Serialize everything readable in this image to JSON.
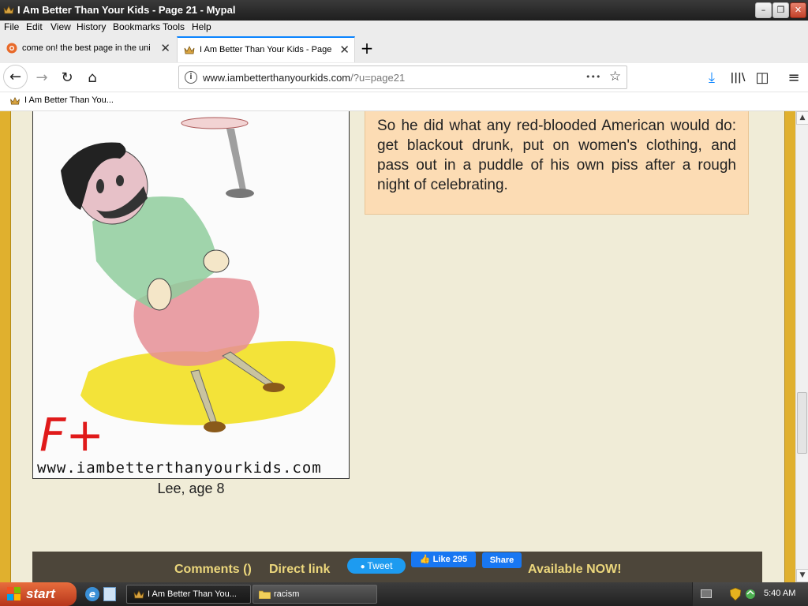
{
  "window": {
    "title": "I Am Better Than Your Kids - Page 21 - Mypal",
    "controls": {
      "minimize": "–",
      "maximize": "❐",
      "close": "✕"
    }
  },
  "menu": [
    "File",
    "Edit",
    "View",
    "History",
    "Bookmarks",
    "Tools",
    "Help"
  ],
  "tabs": [
    {
      "label": "come on! the best page in the uni",
      "icon": "orange-globe-icon",
      "close": "✕",
      "active": false
    },
    {
      "label": "I Am Better Than Your Kids - Page",
      "icon": "crown-icon",
      "close": "✕",
      "active": true
    }
  ],
  "new_tab": "+",
  "nav": {
    "back": "←",
    "forward": "→",
    "reload": "↻",
    "home": "⌂",
    "url_domain": "www.iambetterthanyourkids.com",
    "url_path": "/?u=page21",
    "page_actions": "•••",
    "bookmark_star": "☆",
    "download": "⤓",
    "library": "|||\\",
    "sidebar": "◫",
    "menu": "≡"
  },
  "bookmarks": [
    {
      "label": "I Am Better Than You...",
      "icon": "crown-icon"
    }
  ],
  "page": {
    "drawing_watermark": "www.iambetterthanyourkids.com",
    "grade": "F+",
    "caption": "Lee, age 8",
    "story_text": "So he did what any red-blooded American would do: get blackout drunk, put on women's clothing, and pass out in a puddle of his own piss after a rough night of celebrating.",
    "bottom_links": {
      "comments": "Comments ()",
      "direct_link": "Direct link",
      "tweet": "Tweet",
      "fb_like": "Like 295",
      "fb_share": "Share",
      "available": "Available NOW!"
    },
    "colors": {
      "border": "#e0b02e",
      "background": "#f0ecd7",
      "textbox": "#fcdcb4",
      "bar": "#4d463a",
      "link": "#ecd77c"
    }
  },
  "scrollbar": {
    "up": "▲",
    "down": "▼",
    "position_fraction": 0.68
  },
  "taskbar": {
    "start": "start",
    "tasks": [
      {
        "label": "I Am Better Than You...",
        "icon": "crown-icon",
        "active": true
      },
      {
        "label": "racism",
        "icon": "folder-icon",
        "active": false
      }
    ],
    "clock": "5:40 AM"
  }
}
